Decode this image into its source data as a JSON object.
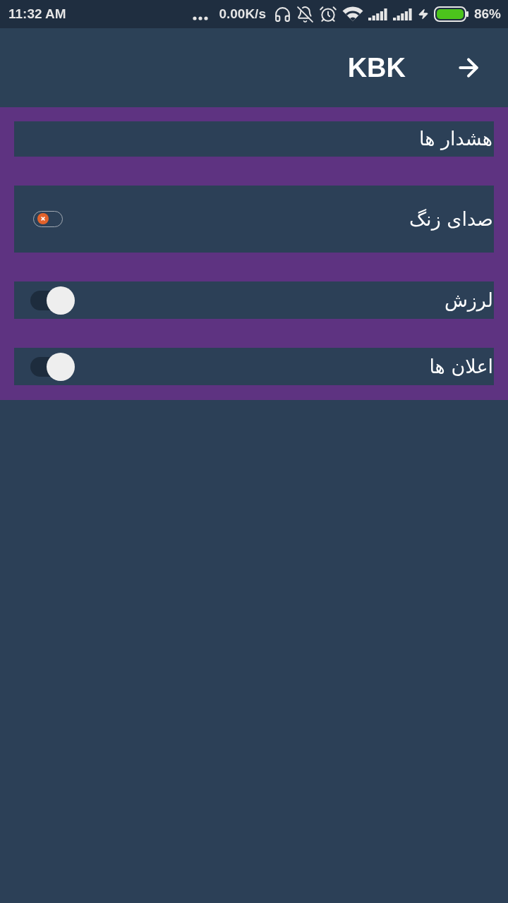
{
  "status_bar": {
    "time": "11:32 AM",
    "network_speed": "0.00K/s",
    "battery_percent": "86%"
  },
  "header": {
    "title": "KBK"
  },
  "alerts_section": {
    "title": "هشدار ها",
    "items": [
      {
        "kind": "compact-switch",
        "label": "صدای زنگ",
        "checked": false
      },
      {
        "kind": "switch",
        "label": "لرزش",
        "checked": true
      },
      {
        "kind": "switch",
        "label": "اعلان ها",
        "checked": true
      }
    ]
  }
}
